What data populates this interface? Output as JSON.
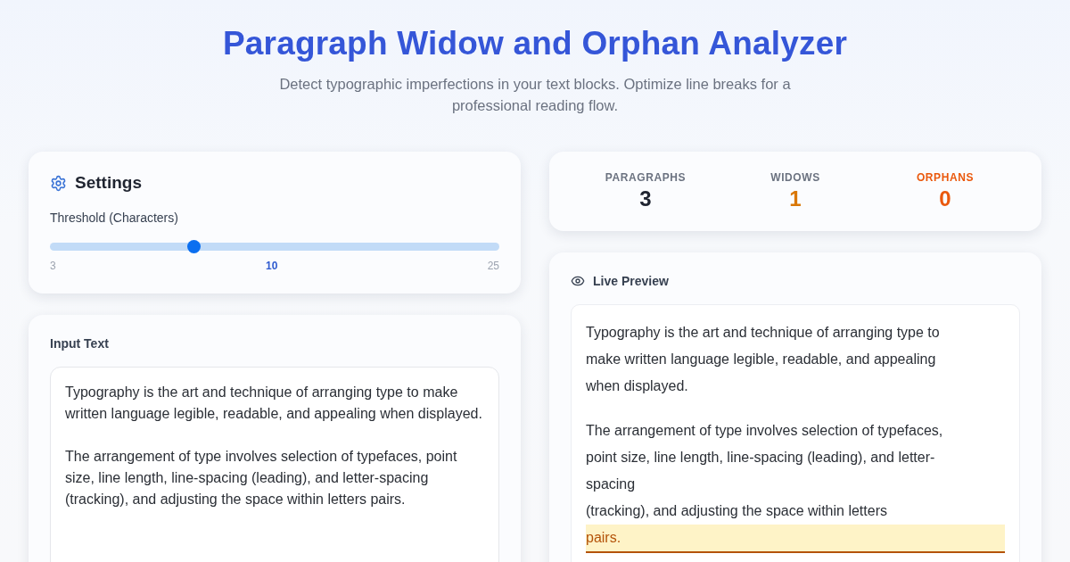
{
  "header": {
    "title": "Paragraph Widow and Orphan Analyzer",
    "subtitle": "Detect typographic imperfections in your text blocks. Optimize line breaks for a professional reading flow."
  },
  "settings": {
    "title": "Settings",
    "threshold": {
      "label": "Threshold (Characters)",
      "level": 0.32,
      "min": "3",
      "value": "10",
      "max": "25"
    }
  },
  "input": {
    "label": "Input Text",
    "value": "Typography is the art and technique of arranging type to make written language legible, readable, and appealing when displayed.\n\nThe arrangement of type involves selection of typefaces, point size, line length, line-spacing (leading), and letter-spacing (tracking), and adjusting the space within letters pairs."
  },
  "stats": [
    {
      "label": "PARAGRAPHS",
      "value": "3",
      "kind": "plain"
    },
    {
      "label": "WIDOWS",
      "value": "1",
      "kind": "widow"
    },
    {
      "label": "ORPHANS",
      "value": "0",
      "kind": "orphan"
    }
  ],
  "preview": {
    "title": "Live Preview",
    "paragraphs": [
      {
        "lines": [
          {
            "text": "Typography is the art and technique of arranging type to",
            "widow": false
          },
          {
            "text": "make written language legible, readable, and appealing",
            "widow": false
          },
          {
            "text": "when displayed.",
            "widow": false
          }
        ]
      },
      {
        "lines": [
          {
            "text": "The arrangement of type involves selection of typefaces,",
            "widow": false
          },
          {
            "text": "point size, line length, line-spacing (leading), and letter-",
            "widow": false
          },
          {
            "text": "spacing",
            "widow": false
          },
          {
            "text": "(tracking), and adjusting the space within letters",
            "widow": false
          },
          {
            "text": "pairs.",
            "widow": true
          }
        ]
      }
    ]
  }
}
